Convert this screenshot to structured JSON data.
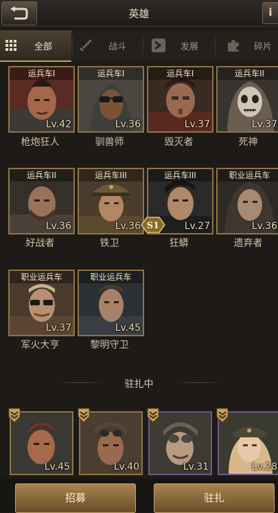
{
  "header": {
    "title": "英雄"
  },
  "tabs": [
    {
      "label": "全部",
      "icon": "grid-icon",
      "active": true
    },
    {
      "label": "战斗",
      "icon": "sword-icon",
      "active": false
    },
    {
      "label": "发展",
      "icon": "develop-icon",
      "active": false
    },
    {
      "label": "碎片",
      "icon": "puzzle-icon",
      "active": false
    }
  ],
  "heroes": [
    {
      "rank": "运兵车I",
      "level": "Lv.42",
      "name": "枪炮狂人"
    },
    {
      "rank": "运兵车I",
      "level": "Lv.36",
      "name": "驯兽师"
    },
    {
      "rank": "运兵车I",
      "level": "Lv.37",
      "name": "毁灭者"
    },
    {
      "rank": "运兵车II",
      "level": "Lv.37",
      "name": "死神"
    },
    {
      "rank": "运兵车II",
      "level": "Lv.36",
      "name": "好战者"
    },
    {
      "rank": "运兵车III",
      "level": "Lv.36",
      "name": "铁卫"
    },
    {
      "rank": "运兵车III",
      "level": "Lv.27",
      "name": "狂蟒"
    },
    {
      "rank": "职业运兵车",
      "level": "Lv.36",
      "name": "遗弃者"
    },
    {
      "rank": "职业运兵车",
      "level": "Lv.37",
      "name": "军火大亨"
    },
    {
      "rank": "职业运兵车",
      "level": "Lv.45",
      "name": "黎明守卫"
    }
  ],
  "badge": {
    "text": "S1"
  },
  "garrison": {
    "title": "驻扎中",
    "heroes": [
      {
        "level": "Lv.45"
      },
      {
        "level": "Lv.40"
      },
      {
        "level": "Lv.31"
      },
      {
        "level": "Lv.28"
      }
    ]
  },
  "buttons": {
    "recruit": "招募",
    "garrison": "驻扎"
  },
  "colors": {
    "accent_gold": "#c9a25b",
    "card_border": "#8f7546",
    "background": "#1d1a17"
  }
}
